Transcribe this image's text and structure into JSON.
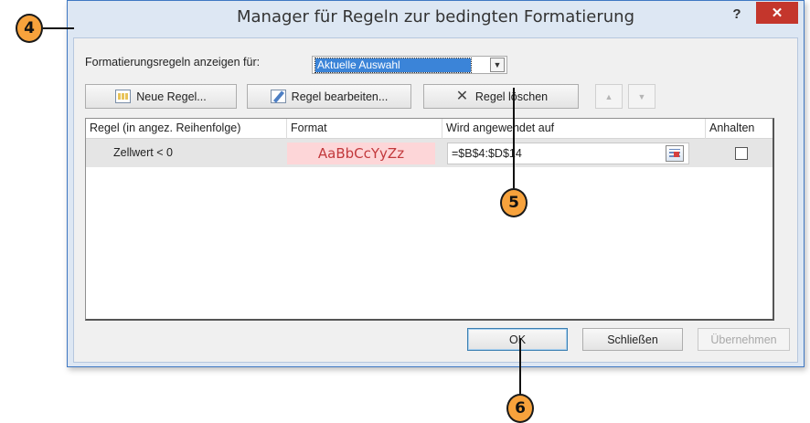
{
  "dialog": {
    "title": "Manager für Regeln zur bedingten Formatierung",
    "help_label": "?",
    "close_label": "✕"
  },
  "show_rules": {
    "label": "Formatierungsregeln anzeigen für:",
    "selected": "Aktuelle Auswahl"
  },
  "toolbar": {
    "new_rule": "Neue Regel...",
    "edit_rule": "Regel bearbeiten...",
    "delete_rule": "Regel löschen",
    "move_up": "▲",
    "move_down": "▼"
  },
  "grid": {
    "columns": [
      "Regel (in angez. Reihenfolge)",
      "Format",
      "Wird angewendet auf",
      "Anhalten"
    ],
    "rows": [
      {
        "rule": "Zellwert < 0",
        "format_preview": "AaBbCcYyZz",
        "applies_to": "=$B$4:$D$14",
        "stop_if_true": false
      }
    ]
  },
  "footer": {
    "ok": "OK",
    "close": "Schließen",
    "apply": "Übernehmen"
  },
  "callouts": [
    "4",
    "5",
    "6"
  ],
  "colors": {
    "accent": "#f7a23c",
    "close_button": "#c4362c",
    "format_preview_bg": "#fdd6d8",
    "format_preview_text": "#c2393c",
    "selection": "#3b84d8"
  }
}
